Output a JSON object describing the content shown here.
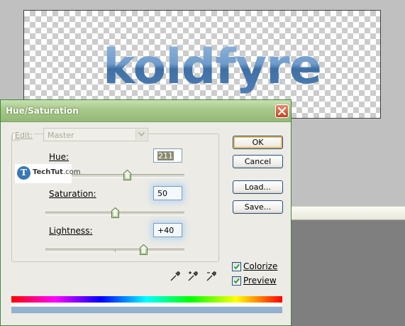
{
  "canvas": {
    "logo_text": "koldfyre"
  },
  "dialog": {
    "title": "Hue/Saturation",
    "edit": {
      "label": "Edit:",
      "value": "Master"
    },
    "hue": {
      "label": "Hue:",
      "value": "211"
    },
    "saturation": {
      "label": "Saturation:",
      "value": "50"
    },
    "lightness": {
      "label": "Lightness:",
      "value": "+40"
    },
    "buttons": {
      "ok": "OK",
      "cancel": "Cancel",
      "load": "Load...",
      "save": "Save..."
    },
    "colorize": {
      "label": "Colorize",
      "checked": true
    },
    "preview": {
      "label": "Preview",
      "checked": true
    },
    "watermark": {
      "initial": "T",
      "name": "TechTut",
      "suffix": ".com"
    },
    "sliders": {
      "hue_value": 211,
      "saturation_value": 50,
      "lightness_value": 40
    }
  },
  "colors": {
    "titlebar": "#a9c98d",
    "result_color": "#93b1cf",
    "logo_blue": "#5a8bc0"
  }
}
